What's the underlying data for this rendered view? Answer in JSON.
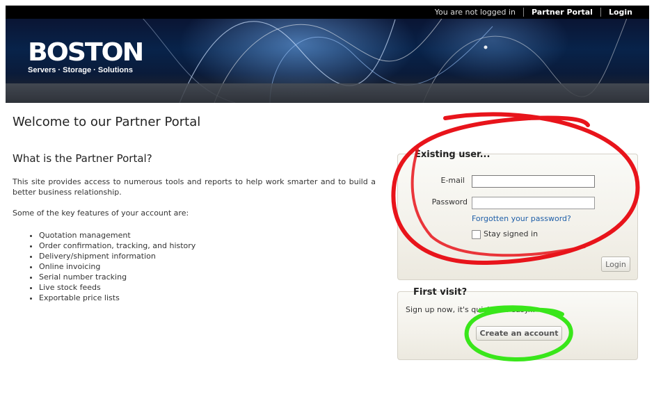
{
  "topbar": {
    "status": "You are not logged in",
    "partner_portal_link": "Partner Portal",
    "login_link": "Login"
  },
  "brand": {
    "logo_text": "BOSTON",
    "tagline": "Servers · Storage · Solutions"
  },
  "content": {
    "page_title": "Welcome to our Partner Portal",
    "section_title": "What is the Partner Portal?",
    "intro": "This site provides access to numerous tools and reports to help work smarter and to build a better business relationship.",
    "features_intro": "Some of the key features of your account are:",
    "features": [
      "Quotation management",
      "Order confirmation, tracking, and history",
      "Delivery/shipment information",
      "Online invoicing",
      "Serial number tracking",
      "Live stock feeds",
      "Exportable price lists"
    ]
  },
  "login_panel": {
    "title": "Existing user...",
    "email_label": "E-mail",
    "email_value": "",
    "password_label": "Password",
    "password_value": "",
    "forgot_link": "Forgotten your password?",
    "stay_signed_in": "Stay signed in",
    "login_button": "Login"
  },
  "first_visit_panel": {
    "title": "First visit?",
    "signup_text": "Sign up now, it's quick and easy...",
    "create_button": "Create an account"
  },
  "colors": {
    "annotation_red": "#e8141b",
    "annotation_green": "#39e61a",
    "link_blue": "#1f5fa8"
  }
}
